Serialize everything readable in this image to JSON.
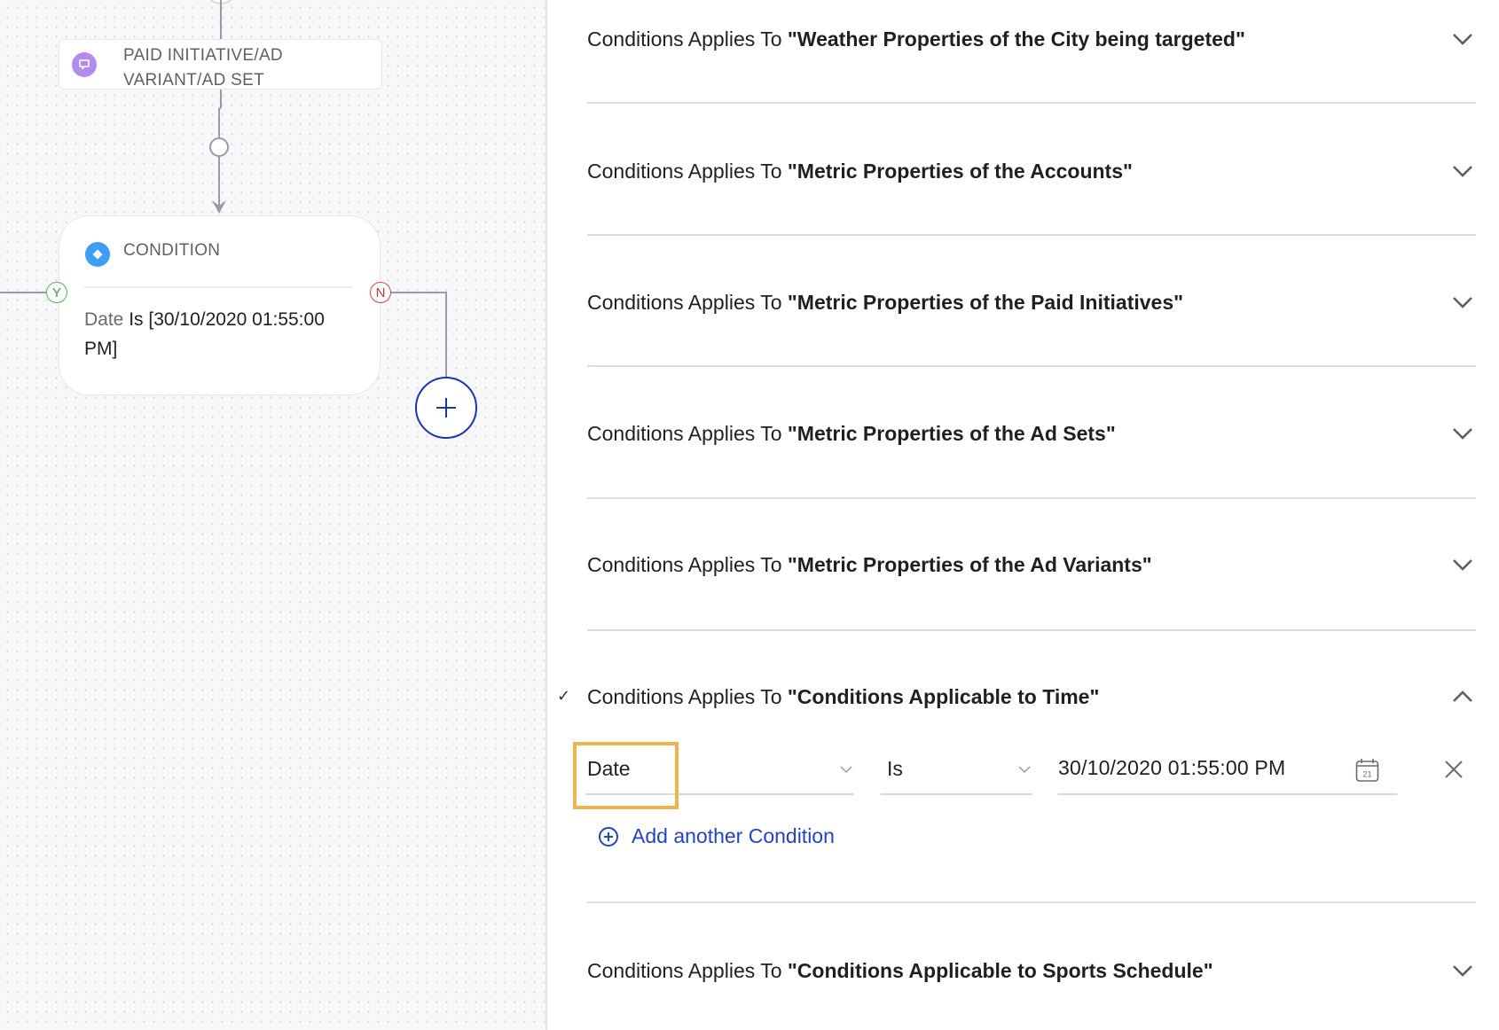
{
  "canvas": {
    "action_node": {
      "label": "PAID INITIATIVE/AD VARIANT/AD SET",
      "icon": "chat-bubble-icon",
      "icon_color": "#b18cf0"
    },
    "condition_node": {
      "title": "CONDITION",
      "icon": "diamond-icon",
      "icon_color": "#3e9ef5",
      "field": "Date",
      "expression": " Is [30/10/2020 01:55:00 PM]"
    },
    "branch_yes": "Y",
    "branch_no": "N",
    "add_node_icon": "plus-icon"
  },
  "panel": {
    "prefix": "Conditions Applies To ",
    "sections": [
      {
        "name": "\"Weather Properties of the City being targeted\"",
        "expanded": false
      },
      {
        "name": "\"Metric Properties of the Accounts\"",
        "expanded": false
      },
      {
        "name": "\"Metric Properties of the Paid Initiatives\"",
        "expanded": false
      },
      {
        "name": "\"Metric Properties of the Ad Sets\"",
        "expanded": false
      },
      {
        "name": "\"Metric Properties of the Ad Variants\"",
        "expanded": false
      },
      {
        "name": "\"Conditions Applicable to Time\"",
        "expanded": true,
        "checked": true
      },
      {
        "name": "\"Conditions Applicable to Sports Schedule\"",
        "expanded": false
      }
    ],
    "condition_row": {
      "field_value": "Date",
      "operator_value": "Is",
      "date_value": "30/10/2020 01:55:00 PM",
      "calendar_day": "21"
    },
    "add_condition_label": "Add another Condition",
    "colors": {
      "link": "#2143c9",
      "highlight": "#f0b44c"
    }
  }
}
